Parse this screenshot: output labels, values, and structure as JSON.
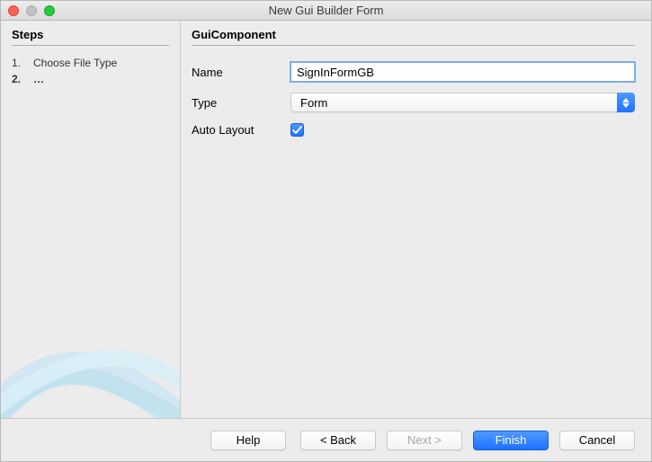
{
  "window": {
    "title": "New Gui Builder Form"
  },
  "sidebar": {
    "heading": "Steps",
    "steps": [
      {
        "num": "1.",
        "label": "Choose File Type",
        "bold": false
      },
      {
        "num": "2.",
        "label": "…",
        "bold": true
      }
    ]
  },
  "main": {
    "heading": "GuiComponent",
    "nameLabel": "Name",
    "nameValue": "SignInFormGB",
    "typeLabel": "Type",
    "typeValue": "Form",
    "autoLayoutLabel": "Auto Layout",
    "autoLayoutChecked": true
  },
  "footer": {
    "help": "Help",
    "back": "< Back",
    "next": "Next >",
    "finish": "Finish",
    "cancel": "Cancel"
  }
}
